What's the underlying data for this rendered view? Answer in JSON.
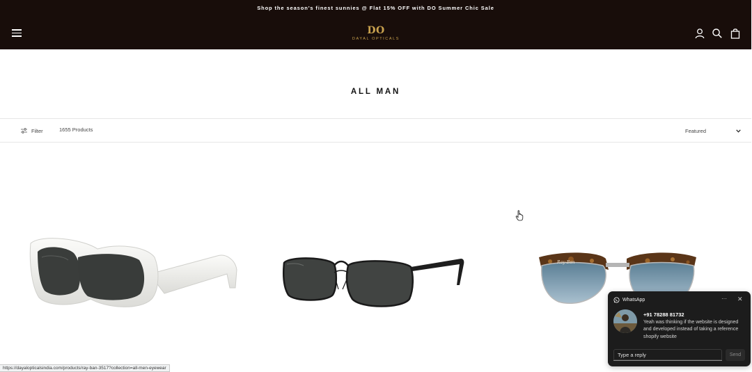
{
  "header": {
    "announcement": "Shop the season's finest sunnies @ Flat 15% OFF with DO Summer Chic Sale",
    "logo_mark": "DO",
    "logo_text": "DAYAL OPTICALS",
    "icons": [
      "menu-icon",
      "user-icon",
      "search-icon",
      "bag-icon"
    ],
    "bg_color": "#180d0a",
    "accent_color": "#c9a24e"
  },
  "collection": {
    "title": "ALL MAN"
  },
  "toolbar": {
    "filter_label": "Filter",
    "product_count": "1655 Products",
    "sort_selected": "Featured"
  },
  "products": [
    {
      "name": "white-prada-sunglasses",
      "alt": "White rectangular sunglasses"
    },
    {
      "name": "black-ray-ban-sunglasses",
      "alt": "Black metal rectangular sunglasses"
    },
    {
      "name": "tortoise-ray-ban-clubmaster",
      "alt": "Tortoise Ray-Ban sunglasses"
    }
  ],
  "status_bar": {
    "url": "https://dayalopticalsindia.com/products/ray-ban-3517?collection=all-men-eyewear"
  },
  "whatsapp": {
    "title": "WhatsApp",
    "more_label": "···",
    "close_label": "✕",
    "phone": "+91 78288 81732",
    "message": "Yeah was thinking if the website is designed and developed instead of taking a reference shopify website",
    "reply_placeholder": "Type a reply",
    "send_label": "Send"
  }
}
